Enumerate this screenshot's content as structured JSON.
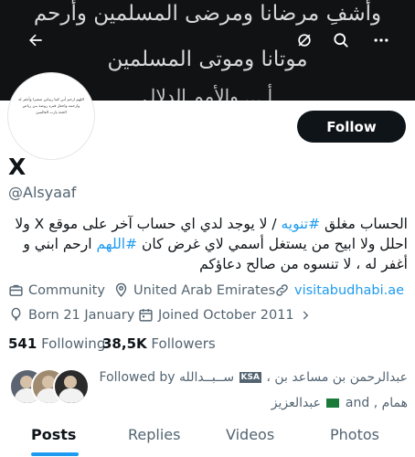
{
  "banner": {
    "lines": [
      "وأشفِ مرضانا ومرضى المسلمين وأرحم",
      "موتانا وموتى المسلمين",
      "أ ... والأمم الدلال"
    ]
  },
  "avatar": {
    "text": "اللهم ارحم أبي كما ربياني صغيرا وأغفر له وارحمه واجعل قبره روضة من رياض الجنة يارب العالمين"
  },
  "header_icons": [
    "back-arrow-icon",
    "translate-icon",
    "search-icon",
    "more-icon"
  ],
  "profile": {
    "display_name": "X",
    "handle": "@Alsyaaf",
    "follow_label": "Follow"
  },
  "bio": {
    "line1_pre": "الحساب مغلق ",
    "tag1": "#تنويه",
    "line1_post": " / لا يوجد لدي اي حساب آخر على موقع X ولا",
    "line2_pre": "احلل ولا ابيح من يستغل أسمي لاي غرض كان ",
    "tag2": "#اللهم",
    "line2_post": " ارحم ابني و",
    "line3": "أغفر له ، لا تنسوه من صالح دعاؤكم"
  },
  "meta": {
    "category": "Community",
    "location": "United Arab Emirates",
    "website": "visitabudhabi.ae",
    "born": "Born 21 January",
    "joined": "Joined October 2011"
  },
  "stats": {
    "following_count": "541",
    "following_label": "Following",
    "followers_count": "38,5K",
    "followers_label": "Followers"
  },
  "followed_by": {
    "line1_prefix": "Followed by",
    "line1_names": "عبدالرحمن بن مساعد بن ،",
    "line1_tail": "ســبــدالله",
    "badge": "KSA",
    "line2_names": "همام ,",
    "line2_and": "and",
    "line2_last": "عبدالعزيز"
  },
  "tabs": [
    "Posts",
    "Replies",
    "Videos",
    "Photos"
  ],
  "colors": {
    "accent": "#1d9bf0",
    "text": "#0f1419",
    "muted": "#536471",
    "banner_bg": "#111214",
    "button_bg": "#0f1419"
  }
}
